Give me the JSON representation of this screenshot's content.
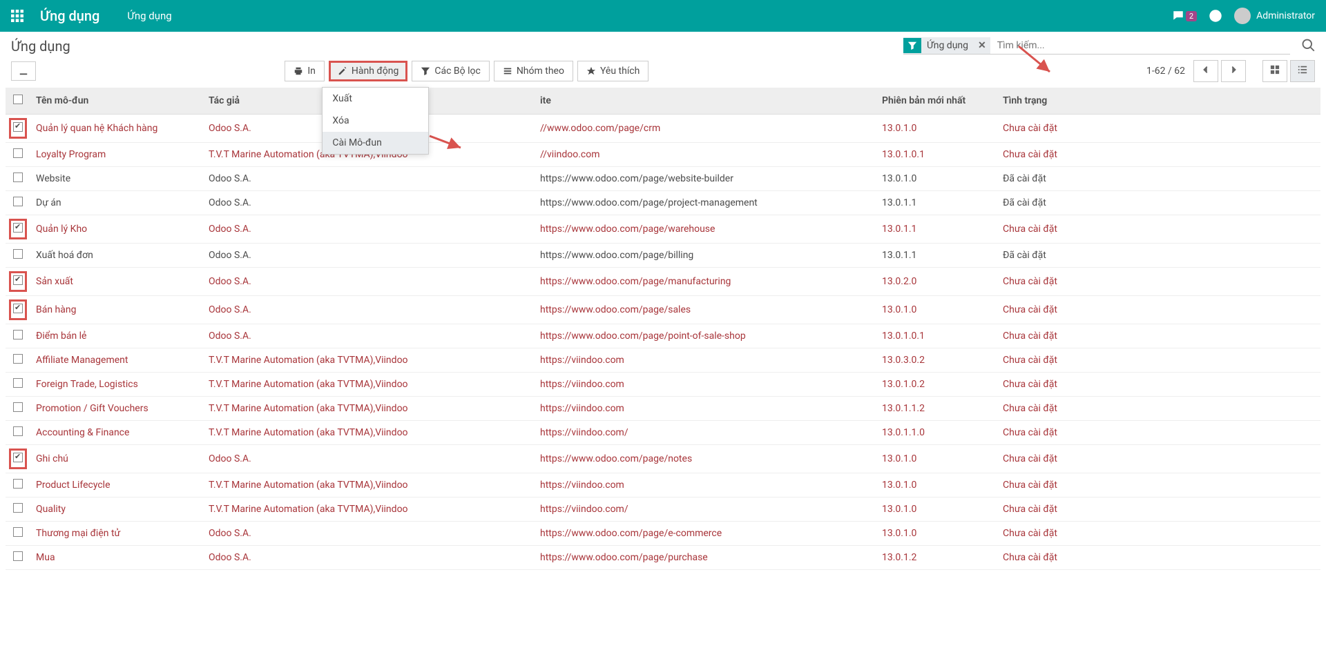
{
  "topnav": {
    "brand": "Ứng dụng",
    "breadcrumb": "Ứng dụng",
    "badge_count": "2",
    "username": "Administrator"
  },
  "cp": {
    "title": "Ứng dụng",
    "facet_label": "Ứng dụng",
    "search_placeholder": "Tìm kiếm...",
    "btn_print": "In",
    "btn_action": "Hành động",
    "btn_filters": "Các Bộ lọc",
    "btn_groupby": "Nhóm theo",
    "btn_favorite": "Yêu thích",
    "pager": "1-62 / 62"
  },
  "dropdown": {
    "export": "Xuất",
    "delete": "Xóa",
    "install": "Cài Mô-đun"
  },
  "table": {
    "headers": {
      "name": "Tên mô-đun",
      "author": "Tác giả",
      "website": "ite",
      "version": "Phiên bản mới nhất",
      "status": "Tình trạng"
    },
    "rows": [
      {
        "checked": true,
        "hl_cb": true,
        "sel": true,
        "name": "Quản lý quan hệ Khách hàng",
        "author": "Odoo S.A.",
        "website": "//www.odoo.com/page/crm",
        "version": "13.0.1.0",
        "status": "Chưa cài đặt"
      },
      {
        "checked": false,
        "hl_cb": false,
        "sel": true,
        "name": "Loyalty Program",
        "author": "T.V.T Marine Automation (aka TVTMA),Viindoo",
        "website": "//viindoo.com",
        "version": "13.0.1.0.1",
        "status": "Chưa cài đặt"
      },
      {
        "checked": false,
        "hl_cb": false,
        "sel": false,
        "name": "Website",
        "author": "Odoo S.A.",
        "website": "https://www.odoo.com/page/website-builder",
        "version": "13.0.1.0",
        "status": "Đã cài đặt"
      },
      {
        "checked": false,
        "hl_cb": false,
        "sel": false,
        "name": "Dự án",
        "author": "Odoo S.A.",
        "website": "https://www.odoo.com/page/project-management",
        "version": "13.0.1.1",
        "status": "Đã cài đặt"
      },
      {
        "checked": true,
        "hl_cb": true,
        "sel": true,
        "name": "Quản lý Kho",
        "author": "Odoo S.A.",
        "website": "https://www.odoo.com/page/warehouse",
        "version": "13.0.1.1",
        "status": "Chưa cài đặt"
      },
      {
        "checked": false,
        "hl_cb": false,
        "sel": false,
        "name": "Xuất hoá đơn",
        "author": "Odoo S.A.",
        "website": "https://www.odoo.com/page/billing",
        "version": "13.0.1.1",
        "status": "Đã cài đặt"
      },
      {
        "checked": true,
        "hl_cb": true,
        "sel": true,
        "name": "Sản xuất",
        "author": "Odoo S.A.",
        "website": "https://www.odoo.com/page/manufacturing",
        "version": "13.0.2.0",
        "status": "Chưa cài đặt"
      },
      {
        "checked": true,
        "hl_cb": true,
        "sel": true,
        "name": "Bán hàng",
        "author": "Odoo S.A.",
        "website": "https://www.odoo.com/page/sales",
        "version": "13.0.1.0",
        "status": "Chưa cài đặt"
      },
      {
        "checked": false,
        "hl_cb": false,
        "sel": true,
        "name": "Điểm bán lẻ",
        "author": "Odoo S.A.",
        "website": "https://www.odoo.com/page/point-of-sale-shop",
        "version": "13.0.1.0.1",
        "status": "Chưa cài đặt"
      },
      {
        "checked": false,
        "hl_cb": false,
        "sel": true,
        "name": "Affiliate Management",
        "author": "T.V.T Marine Automation (aka TVTMA),Viindoo",
        "website": "https://viindoo.com",
        "version": "13.0.3.0.2",
        "status": "Chưa cài đặt"
      },
      {
        "checked": false,
        "hl_cb": false,
        "sel": true,
        "name": "Foreign Trade, Logistics",
        "author": "T.V.T Marine Automation (aka TVTMA),Viindoo",
        "website": "https://viindoo.com",
        "version": "13.0.1.0.2",
        "status": "Chưa cài đặt"
      },
      {
        "checked": false,
        "hl_cb": false,
        "sel": true,
        "name": "Promotion / Gift Vouchers",
        "author": "T.V.T Marine Automation (aka TVTMA),Viindoo",
        "website": "https://viindoo.com",
        "version": "13.0.1.1.2",
        "status": "Chưa cài đặt"
      },
      {
        "checked": false,
        "hl_cb": false,
        "sel": true,
        "name": "Accounting & Finance",
        "author": "T.V.T Marine Automation (aka TVTMA),Viindoo",
        "website": "https://viindoo.com/",
        "version": "13.0.1.1.0",
        "status": "Chưa cài đặt"
      },
      {
        "checked": true,
        "hl_cb": true,
        "sel": true,
        "name": "Ghi chú",
        "author": "Odoo S.A.",
        "website": "https://www.odoo.com/page/notes",
        "version": "13.0.1.0",
        "status": "Chưa cài đặt"
      },
      {
        "checked": false,
        "hl_cb": false,
        "sel": true,
        "name": "Product Lifecycle",
        "author": "T.V.T Marine Automation (aka TVTMA),Viindoo",
        "website": "https://viindoo.com",
        "version": "13.0.1.0",
        "status": "Chưa cài đặt"
      },
      {
        "checked": false,
        "hl_cb": false,
        "sel": true,
        "name": "Quality",
        "author": "T.V.T Marine Automation (aka TVTMA),Viindoo",
        "website": "https://viindoo.com/",
        "version": "13.0.1.0",
        "status": "Chưa cài đặt"
      },
      {
        "checked": false,
        "hl_cb": false,
        "sel": true,
        "name": "Thương mại điện tử",
        "author": "Odoo S.A.",
        "website": "https://www.odoo.com/page/e-commerce",
        "version": "13.0.1.0",
        "status": "Chưa cài đặt"
      },
      {
        "checked": false,
        "hl_cb": false,
        "sel": true,
        "name": "Mua",
        "author": "Odoo S.A.",
        "website": "https://www.odoo.com/page/purchase",
        "version": "13.0.1.2",
        "status": "Chưa cài đặt"
      }
    ]
  }
}
